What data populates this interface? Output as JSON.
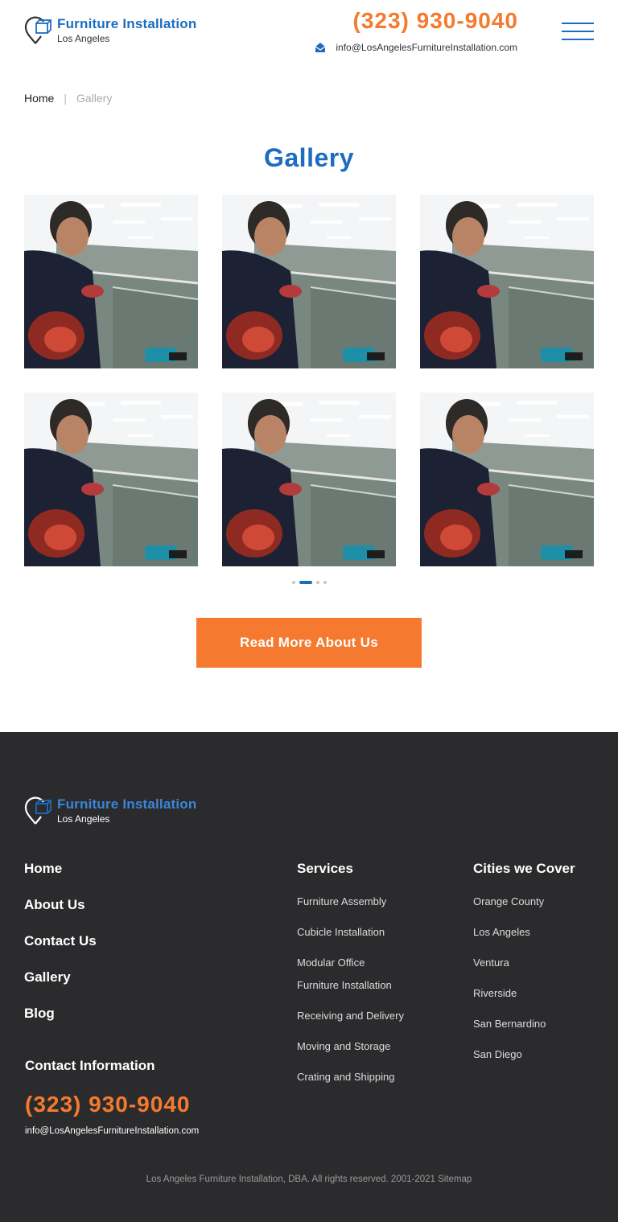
{
  "colors": {
    "brand_blue": "#1c6dc2",
    "accent_orange": "#f47a2e",
    "footer_bg": "#2b2b2d"
  },
  "header": {
    "logo_title": "Furniture Installation",
    "logo_subtitle": "Los Angeles",
    "logo_icon": "location-pin-box-icon",
    "phone": "(323) 930-9040",
    "email": "info@LosAngelesFurnitureInstallation.com",
    "email_icon": "envelope-icon",
    "menu_icon": "hamburger-menu-icon"
  },
  "breadcrumb": {
    "home": "Home",
    "separator": "|",
    "current": "Gallery"
  },
  "gallery": {
    "title": "Gallery",
    "photos": [
      {
        "subject": "worker-installing-cubicle"
      },
      {
        "subject": "worker-installing-cubicle"
      },
      {
        "subject": "worker-installing-cubicle"
      },
      {
        "subject": "worker-installing-cubicle"
      },
      {
        "subject": "worker-installing-cubicle"
      },
      {
        "subject": "worker-installing-cubicle"
      }
    ],
    "pagination": {
      "pages": 4,
      "active": 2
    },
    "cta_label": "Read More About Us"
  },
  "footer": {
    "logo_title": "Furniture Installation",
    "logo_subtitle": "Los Angeles",
    "nav": [
      "Home",
      "About Us",
      "Contact Us",
      "Gallery",
      "Blog"
    ],
    "services_heading": "Services",
    "services": [
      "Furniture Assembly",
      "Cubicle Installation",
      "Modular Office",
      "Furniture Installation",
      "Receiving and Delivery",
      "Moving and Storage",
      "Crating and Shipping"
    ],
    "cities_heading": "Cities we Cover",
    "cities": [
      "Orange County",
      "Los Angeles",
      "Ventura",
      "Riverside",
      "San Bernardino",
      "San Diego"
    ],
    "contact_heading": "Contact Information",
    "contact_phone": "(323) 930-9040",
    "contact_email": "info@LosAngelesFurnitureInstallation.com",
    "copyright": "Los Angeles Furniture Installation, DBA. All rights reserved. 2001-2021",
    "sitemap": "Sitemap"
  }
}
